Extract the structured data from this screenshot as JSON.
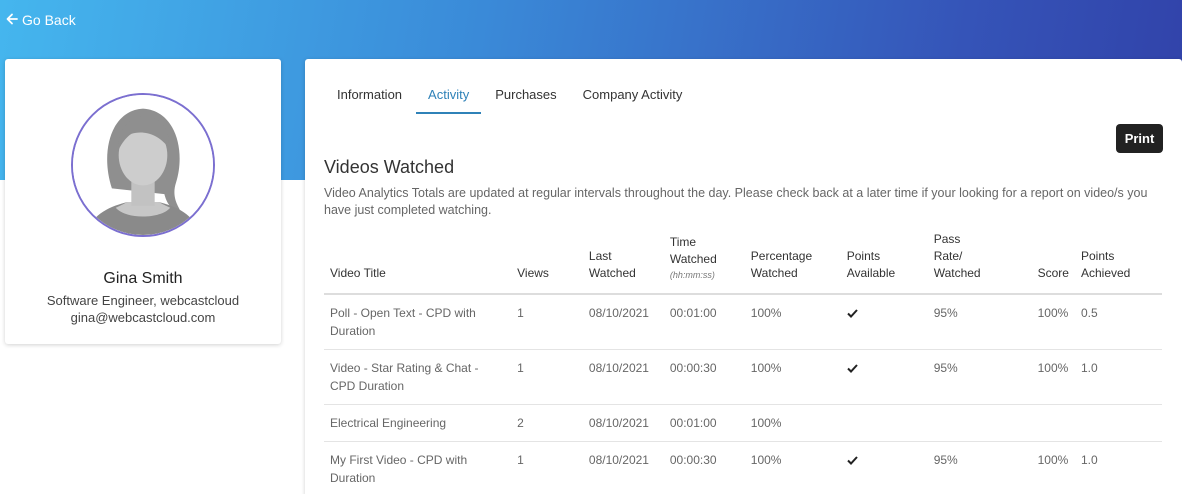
{
  "nav": {
    "go_back_label": "Go Back"
  },
  "profile": {
    "name": "Gina Smith",
    "role": "Software Engineer, webcastcloud",
    "email": "gina@webcastcloud.com"
  },
  "tabs": [
    {
      "label": "Information",
      "active": false
    },
    {
      "label": "Activity",
      "active": true
    },
    {
      "label": "Purchases",
      "active": false
    },
    {
      "label": "Company Activity",
      "active": false
    }
  ],
  "print_label": "Print",
  "videos": {
    "title": "Videos Watched",
    "description": "Video Analytics Totals are updated at regular intervals throughout the day. Please check back at a later time if your looking for a report on video/s you have just completed watching.",
    "columns": {
      "title": "Video Title",
      "views": "Views",
      "last_watched": "Last Watched",
      "time_watched": "Time Watched",
      "time_watched_sub": "(hh:mm:ss)",
      "percentage": "Percentage Watched",
      "points_available": "Points Available",
      "pass_rate": "Pass Rate/ Watched",
      "score": "Score",
      "points_achieved": "Points Achieved"
    },
    "rows": [
      {
        "title": "Poll - Open Text - CPD with Duration",
        "views": "1",
        "last_watched": "08/10/2021",
        "time_watched": "00:01:00",
        "percentage": "100%",
        "points_available": true,
        "pass_rate": "95%",
        "score": "100%",
        "points_achieved": "0.5"
      },
      {
        "title": "Video - Star Rating & Chat - CPD Duration",
        "views": "1",
        "last_watched": "08/10/2021",
        "time_watched": "00:00:30",
        "percentage": "100%",
        "points_available": true,
        "pass_rate": "95%",
        "score": "100%",
        "points_achieved": "1.0"
      },
      {
        "title": "Electrical Engineering",
        "views": "2",
        "last_watched": "08/10/2021",
        "time_watched": "00:01:00",
        "percentage": "100%",
        "points_available": false,
        "pass_rate": "",
        "score": "",
        "points_achieved": ""
      },
      {
        "title": "My First Video - CPD with Duration",
        "views": "1",
        "last_watched": "08/10/2021",
        "time_watched": "00:00:30",
        "percentage": "100%",
        "points_available": true,
        "pass_rate": "95%",
        "score": "100%",
        "points_achieved": "1.0"
      }
    ]
  },
  "colors": {
    "accent": "#2f82b8",
    "avatar_ring": "#7b6fd0",
    "header_gradient_start": "#45b6ee",
    "header_gradient_end": "#3142a9",
    "print_button": "#222222"
  },
  "icons": {
    "go_back": "arrow-left-icon",
    "points_available": "check-icon",
    "avatar": "user-avatar-placeholder"
  }
}
